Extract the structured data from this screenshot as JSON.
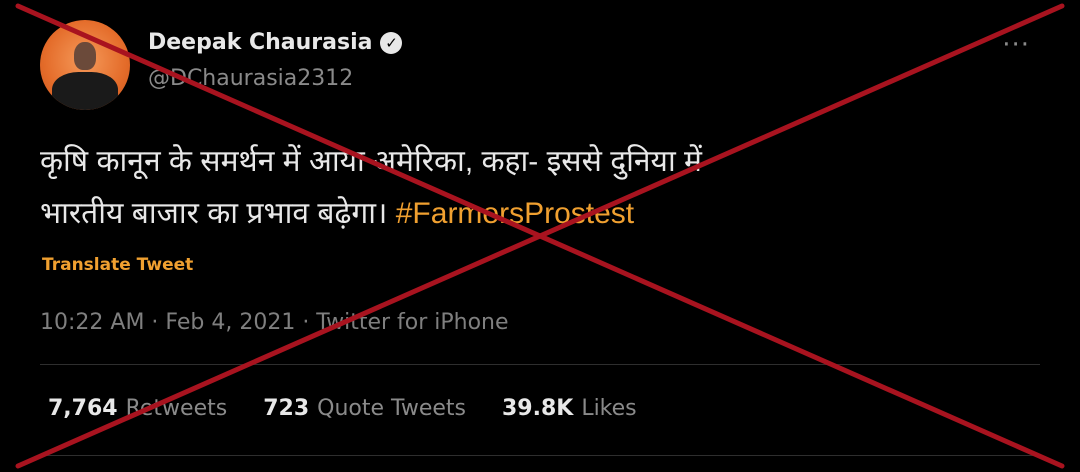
{
  "user": {
    "name": "Deepak Chaurasia",
    "handle": "@DChaurasia2312"
  },
  "tweet": {
    "text_line1": "कृषि कानून के समर्थन में आया अमेरिका, कहा- इससे दुनिया में",
    "text_line2": "भारतीय बाजार का प्रभाव बढ़ेगा। ",
    "hashtag": "#FarmersProstest",
    "translate_label": "Translate Tweet",
    "meta": "10:22 AM · Feb 4, 2021 · Twitter for iPhone"
  },
  "stats": [
    {
      "value": "7,764",
      "label": "Retweets"
    },
    {
      "value": "723",
      "label": "Quote Tweets"
    },
    {
      "value": "39.8K",
      "label": "Likes"
    }
  ],
  "icons": {
    "verified": "verified-badge-icon",
    "more": "more-options-icon"
  },
  "colors": {
    "background": "#000000",
    "hashtag": "#f0a030",
    "cross": "#a8131f"
  }
}
